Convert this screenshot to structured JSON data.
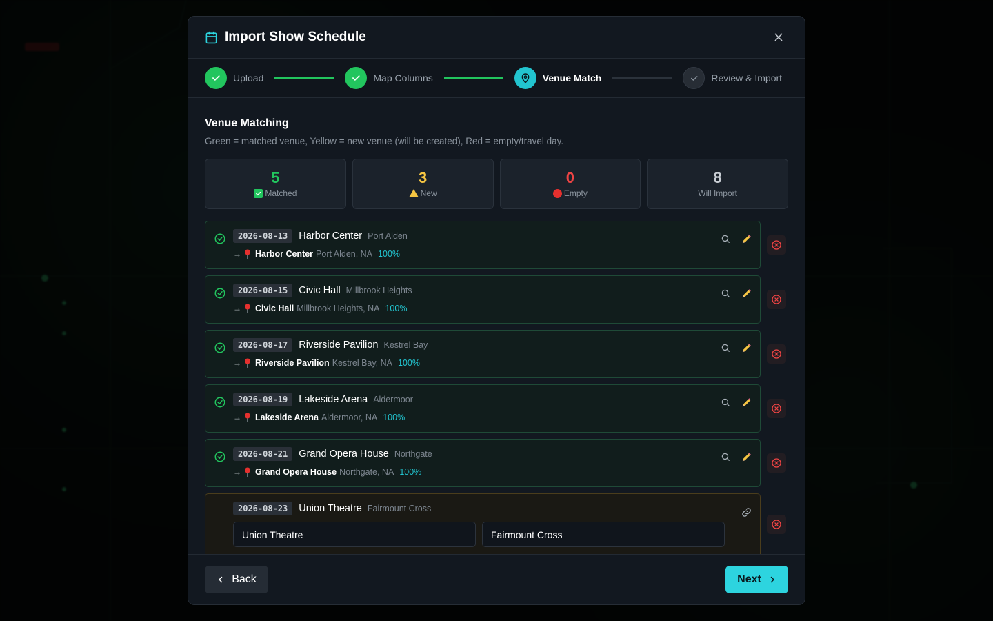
{
  "modal": {
    "title": "Import Show Schedule",
    "icon": "calendar-icon"
  },
  "stepper": {
    "steps": [
      {
        "label": "Upload",
        "state": "done"
      },
      {
        "label": "Map Columns",
        "state": "done"
      },
      {
        "label": "Venue Match",
        "state": "active"
      },
      {
        "label": "Review & Import",
        "state": "pending"
      }
    ]
  },
  "section": {
    "title": "Venue Matching",
    "description": "Green = matched venue, Yellow = new venue (will be created), Red = empty/travel day."
  },
  "stats": [
    {
      "value": "5",
      "label": "Matched",
      "color": "#22c55e",
      "icon": "check-box-icon"
    },
    {
      "value": "3",
      "label": "New",
      "color": "#f5c542",
      "icon": "warning-icon"
    },
    {
      "value": "0",
      "label": "Empty",
      "color": "#ef4444",
      "icon": "red-circle-icon"
    },
    {
      "value": "8",
      "label": "Will Import",
      "color": "#c9ced4",
      "icon": ""
    }
  ],
  "rows": [
    {
      "date": "2026-08-13",
      "venue": "Harbor Center",
      "city": "Port Alden",
      "arrow": "→",
      "match_name": "Harbor Center",
      "match_location": "Port Alden, NA",
      "match_pct": "100%"
    },
    {
      "date": "2026-08-15",
      "venue": "Civic Hall",
      "city": "Millbrook Heights",
      "arrow": "→",
      "match_name": "Civic Hall",
      "match_location": "Millbrook Heights, NA",
      "match_pct": "100%"
    },
    {
      "date": "2026-08-17",
      "venue": "Riverside Pavilion",
      "city": "Kestrel Bay",
      "arrow": "→",
      "match_name": "Riverside Pavilion",
      "match_location": "Kestrel Bay, NA",
      "match_pct": "100%"
    },
    {
      "date": "2026-08-19",
      "venue": "Lakeside Arena",
      "city": "Aldermoor",
      "arrow": "→",
      "match_name": "Lakeside Arena",
      "match_location": "Aldermoor, NA",
      "match_pct": "100%"
    },
    {
      "date": "2026-08-21",
      "venue": "Grand Opera House",
      "city": "Northgate",
      "arrow": "→",
      "match_name": "Grand Opera House",
      "match_location": "Northgate, NA",
      "match_pct": "100%"
    }
  ],
  "new_row": {
    "date": "2026-08-23",
    "venue": "Union Theatre",
    "city": "Fairmount Cross",
    "venue_input": "Union Theatre",
    "city_input": "Fairmount Cross"
  },
  "footer": {
    "back_label": "Back",
    "next_label": "Next"
  },
  "colors": {
    "accent": "#2dd4df",
    "success": "#22c55e",
    "warning": "#f5c542",
    "danger": "#ef4444"
  }
}
